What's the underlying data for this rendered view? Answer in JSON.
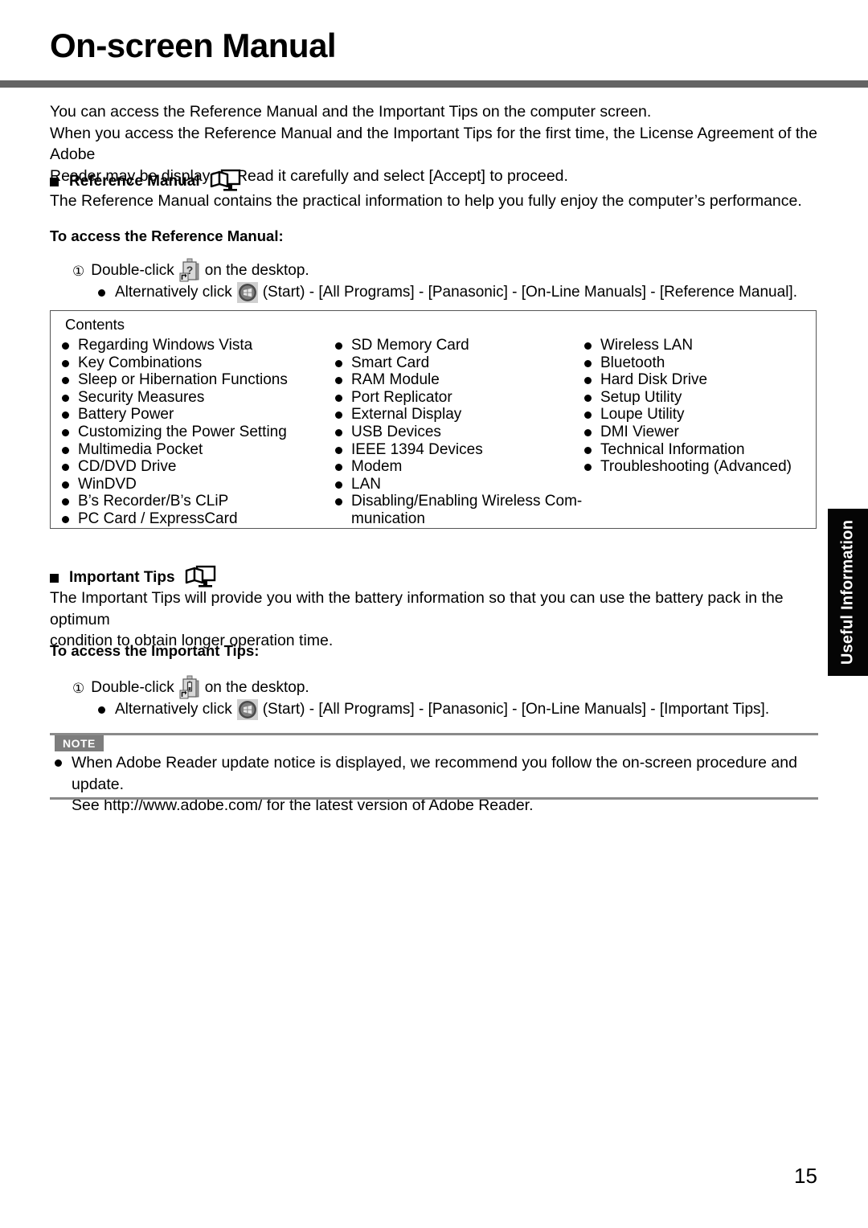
{
  "header": {
    "title": "On-screen Manual"
  },
  "intro": {
    "line1": "You can access the Reference Manual and the Important Tips on the computer screen.",
    "line2": "When you access the Reference Manual and the Important Tips for the first time, the License Agreement of the Adobe",
    "line3": "Reader may be displayed. Read it carefully and select [Accept] to proceed."
  },
  "reference_manual": {
    "heading": "Reference Manual",
    "description": "The Reference Manual contains the practical information to help you fully enjoy the computer’s performance.",
    "subheading": "To access the Reference Manual:",
    "step_number": "①",
    "step_prefix": "Double-click",
    "step_suffix": "on the desktop.",
    "alt_prefix": "Alternatively click",
    "alt_suffix": "(Start) - [All Programs] - [Panasonic] - [On-Line Manuals] - [Reference Manual]."
  },
  "contents": {
    "label": "Contents",
    "column1": [
      "Regarding Windows Vista",
      "Key Combinations",
      "Sleep or Hibernation Functions",
      "Security Measures",
      "Battery Power",
      "Customizing the Power Setting",
      "Multimedia Pocket",
      "CD/DVD Drive",
      "WinDVD",
      "B’s Recorder/B’s CLiP",
      "PC Card / ExpressCard"
    ],
    "column2": [
      "SD Memory Card",
      "Smart Card",
      "RAM Module",
      "Port Replicator",
      "External Display",
      "USB Devices",
      "IEEE 1394 Devices",
      "Modem",
      "LAN",
      "Disabling/Enabling Wireless Com-"
    ],
    "column2_continuation": "munication",
    "column3": [
      "Wireless LAN",
      "Bluetooth",
      "Hard Disk Drive",
      "Setup Utility",
      "Loupe Utility",
      "DMI Viewer",
      "Technical Information",
      "Troubleshooting (Advanced)"
    ]
  },
  "important_tips": {
    "heading": "Important Tips",
    "description_line1": "The Important Tips will provide you with the battery information so that you can use the battery pack in the optimum",
    "description_line2": "condition to obtain longer operation time.",
    "subheading": "To access the Important Tips:",
    "step_number": "①",
    "step_prefix": "Double-click",
    "step_suffix": "on the desktop.",
    "alt_prefix": "Alternatively click",
    "alt_suffix": "(Start) - [All Programs] - [Panasonic] - [On-Line Manuals] - [Important Tips]."
  },
  "note": {
    "badge": "NOTE",
    "line1": "When Adobe Reader update notice is displayed, we recommend you follow the on-screen procedure and update.",
    "line2": "See http://www.adobe.com/ for the latest version of Adobe Reader."
  },
  "side_tab": {
    "label": "Useful Information"
  },
  "footer": {
    "page_number": "15"
  },
  "colors": {
    "title_rule": "#646464",
    "note_rule": "#8a8a8a",
    "note_badge_bg": "#7d7d7d",
    "side_tab_bg": "#050505",
    "box_border": "#555555"
  }
}
